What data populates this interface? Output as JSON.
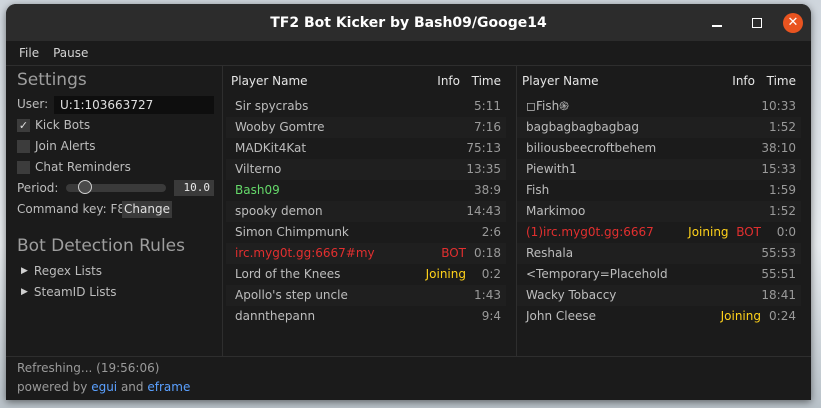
{
  "window": {
    "title": "TF2 Bot Kicker by Bash09/Googe14"
  },
  "menu": {
    "items": [
      "File",
      "Pause"
    ]
  },
  "settings": {
    "heading": "Settings",
    "user_label": "User:",
    "user_value": "U:1:103663727",
    "kick_bots": {
      "label": "Kick Bots",
      "checked": true
    },
    "join_alerts": {
      "label": "Join Alerts",
      "checked": false
    },
    "chat_reminders": {
      "label": "Chat Reminders",
      "checked": false
    },
    "period_label": "Period:",
    "period_value": "10.0",
    "command_key_label": "Command key: F8",
    "change_button": "Change"
  },
  "rules": {
    "heading": "Bot Detection Rules",
    "regex_lists": "Regex Lists",
    "steamid_lists": "SteamID Lists"
  },
  "table_headers": {
    "name": "Player Name",
    "info": "Info",
    "time": "Time"
  },
  "left_players": [
    {
      "name": "Sir spycrabs",
      "info": "",
      "time": "5:11",
      "name_color": "default"
    },
    {
      "name": "Wooby Gomtre",
      "info": "",
      "time": "7:16",
      "name_color": "default"
    },
    {
      "name": "MADKit4Kat",
      "info": "",
      "time": "75:13",
      "name_color": "default"
    },
    {
      "name": "Vilterno",
      "info": "",
      "time": "13:35",
      "name_color": "default"
    },
    {
      "name": "Bash09",
      "info": "",
      "time": "38:9",
      "name_color": "green"
    },
    {
      "name": "spooky demon",
      "info": "",
      "time": "14:43",
      "name_color": "default"
    },
    {
      "name": "Simon Chimpmunk",
      "info": "",
      "time": "2:6",
      "name_color": "default"
    },
    {
      "name": "irc.myg0t.gg:6667#my",
      "info": "BOT",
      "time": "0:18",
      "name_color": "red"
    },
    {
      "name": "Lord of the Knees",
      "info": "Joining",
      "time": "0:2",
      "name_color": "default"
    },
    {
      "name": "Apollo's step uncle",
      "info": "",
      "time": "1:43",
      "name_color": "default"
    },
    {
      "name": "dannthepann",
      "info": "",
      "time": "9:4",
      "name_color": "default"
    }
  ],
  "right_players": [
    {
      "name": "◻Fish֍",
      "info": "",
      "time": "10:33",
      "name_color": "default"
    },
    {
      "name": "bagbagbagbagbag",
      "info": "",
      "time": "1:52",
      "name_color": "default"
    },
    {
      "name": "biliousbeecroftbehem",
      "info": "",
      "time": "38:10",
      "name_color": "default"
    },
    {
      "name": "Piewith1",
      "info": "",
      "time": "15:33",
      "name_color": "default"
    },
    {
      "name": "Fish",
      "info": "",
      "time": "1:59",
      "name_color": "default"
    },
    {
      "name": "Markimoo",
      "info": "",
      "time": "1:52",
      "name_color": "default"
    },
    {
      "name": "(1)irc.myg0t.gg:6667",
      "info": "Joining  BOT",
      "time": "0:0",
      "name_color": "red"
    },
    {
      "name": "Reshala",
      "info": "",
      "time": "55:53",
      "name_color": "default"
    },
    {
      "name": "<Temporary=Placehold",
      "info": "",
      "time": "55:51",
      "name_color": "default"
    },
    {
      "name": "Wacky Tobaccy",
      "info": "",
      "time": "18:41",
      "name_color": "default"
    },
    {
      "name": "John Cleese",
      "info": "Joining",
      "time": "0:24",
      "name_color": "default"
    }
  ],
  "status": {
    "refreshing": "Refreshing... (19:56:06)",
    "powered_prefix": "powered by ",
    "egui": "egui",
    "and": " and ",
    "eframe": "eframe"
  },
  "colors": {
    "bot": "#e22f2f",
    "joining": "#ffd21a",
    "self": "#65d96a",
    "link": "#5aa0ff",
    "close": "#e95420"
  }
}
